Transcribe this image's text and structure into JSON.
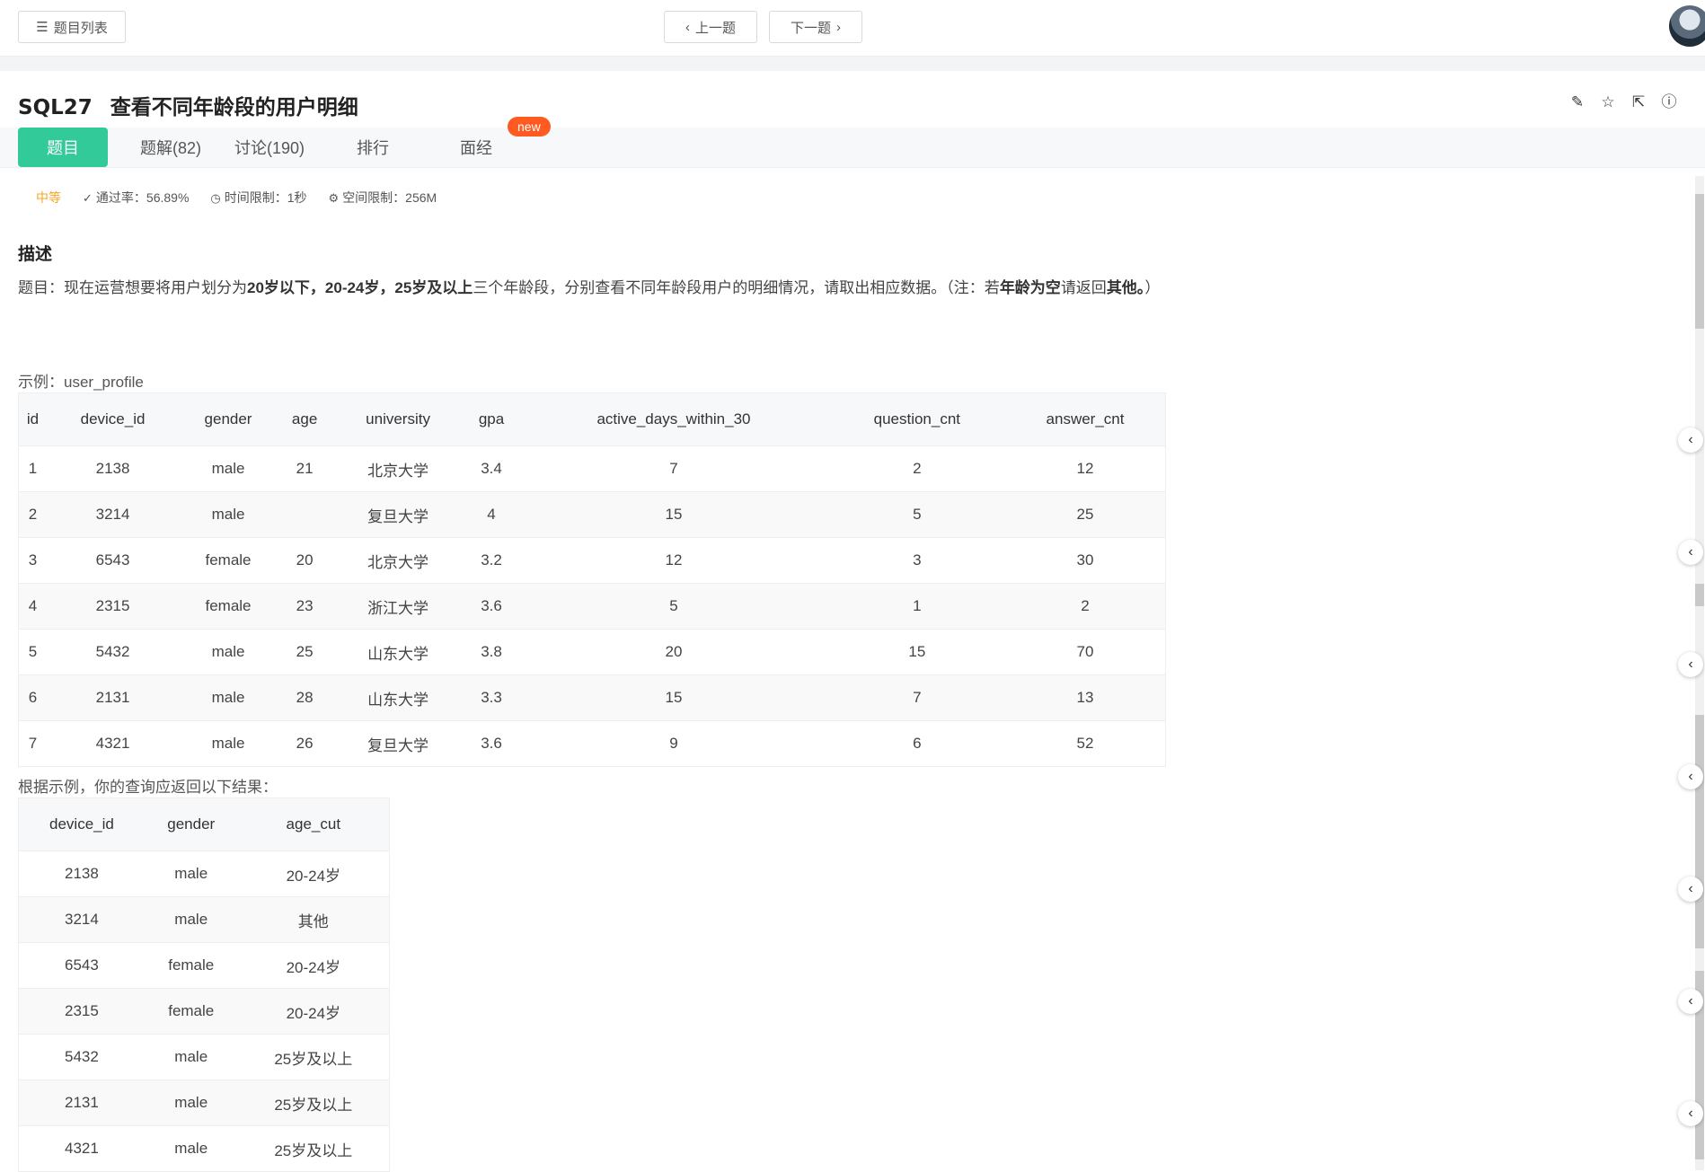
{
  "topbar": {
    "list_label": "题目列表",
    "prev_label": "上一题",
    "next_label": "下一题"
  },
  "problem": {
    "code": "SQL27",
    "title": "查看不同年龄段的用户明细"
  },
  "tabs": [
    {
      "label": "题目",
      "active": true
    },
    {
      "label": "题解(82)"
    },
    {
      "label": "讨论(190)"
    },
    {
      "label": "排行"
    },
    {
      "label": "面经",
      "badge": "new"
    }
  ],
  "meta": {
    "difficulty": "中等",
    "pass_rate": "通过率：56.89%",
    "time_limit": "时间限制：1秒",
    "space_limit": "空间限制：256M"
  },
  "description": {
    "heading": "描述",
    "p1": "题目：现在运营想要将用户划分为",
    "b1": "20岁以下，20-24岁，25岁及以上",
    "p2": "三个年龄段，分别查看不同年龄段用户的明细情况，请取出相应数据。（注：若",
    "b2": "年龄为空",
    "p3": "请返回",
    "b3": "其他。",
    "p4": "）"
  },
  "example": {
    "label": "示例：user_profile",
    "headers": [
      "id",
      "device_id",
      "gender",
      "age",
      "university",
      "gpa",
      "active_days_within_30",
      "question_cnt",
      "answer_cnt"
    ],
    "rows": [
      [
        "1",
        "2138",
        "male",
        "21",
        "北京大学",
        "3.4",
        "7",
        "2",
        "12"
      ],
      [
        "2",
        "3214",
        "male",
        "",
        "复旦大学",
        "4",
        "15",
        "5",
        "25"
      ],
      [
        "3",
        "6543",
        "female",
        "20",
        "北京大学",
        "3.2",
        "12",
        "3",
        "30"
      ],
      [
        "4",
        "2315",
        "female",
        "23",
        "浙江大学",
        "3.6",
        "5",
        "1",
        "2"
      ],
      [
        "5",
        "5432",
        "male",
        "25",
        "山东大学",
        "3.8",
        "20",
        "15",
        "70"
      ],
      [
        "6",
        "2131",
        "male",
        "28",
        "山东大学",
        "3.3",
        "15",
        "7",
        "13"
      ],
      [
        "7",
        "4321",
        "male",
        "26",
        "复旦大学",
        "3.6",
        "9",
        "6",
        "52"
      ]
    ]
  },
  "result": {
    "label": "根据示例，你的查询应返回以下结果：",
    "headers": [
      "device_id",
      "gender",
      "age_cut"
    ],
    "rows": [
      [
        "2138",
        "male",
        "20-24岁"
      ],
      [
        "3214",
        "male",
        "其他"
      ],
      [
        "6543",
        "female",
        "20-24岁"
      ],
      [
        "2315",
        "female",
        "20-24岁"
      ],
      [
        "5432",
        "male",
        "25岁及以上"
      ],
      [
        "2131",
        "male",
        "25岁及以上"
      ],
      [
        "4321",
        "male",
        "25岁及以上"
      ]
    ]
  },
  "colors": {
    "accent": "#32ca99",
    "new_badge": "#ff5a1f",
    "difficulty": "#f5a623"
  }
}
